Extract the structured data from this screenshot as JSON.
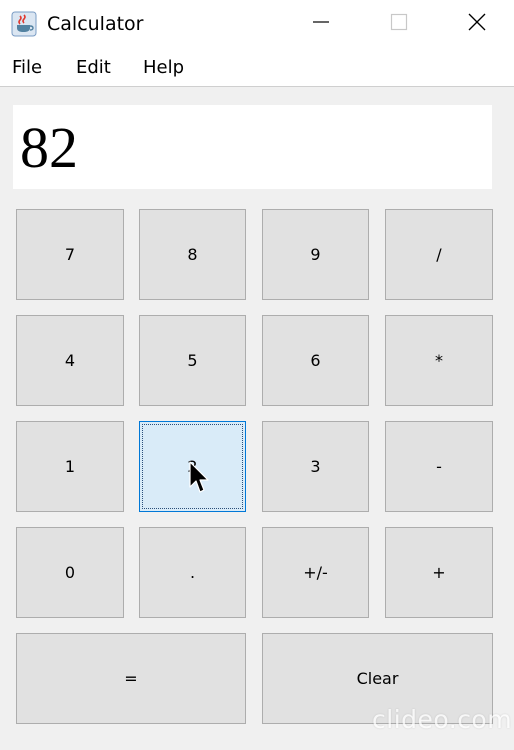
{
  "window": {
    "title": "Calculator",
    "icon": "java-cup-icon",
    "controls": [
      "minimize-icon",
      "maximize-icon",
      "close-icon"
    ]
  },
  "menubar": {
    "items": [
      {
        "label": "File"
      },
      {
        "label": "Edit"
      },
      {
        "label": "Help"
      }
    ]
  },
  "display": {
    "value": "82"
  },
  "keypad": {
    "keys": [
      {
        "label": "7"
      },
      {
        "label": "8"
      },
      {
        "label": "9"
      },
      {
        "label": "/"
      },
      {
        "label": "4"
      },
      {
        "label": "5"
      },
      {
        "label": "6"
      },
      {
        "label": "*"
      },
      {
        "label": "1"
      },
      {
        "label": "2"
      },
      {
        "label": "3"
      },
      {
        "label": "-"
      },
      {
        "label": "0"
      },
      {
        "label": "."
      },
      {
        "label": "+/-"
      },
      {
        "label": "+"
      },
      {
        "label": "="
      },
      {
        "label": "Clear"
      }
    ],
    "focused_key": "2"
  },
  "watermark": {
    "text": "clideo.com"
  },
  "colors": {
    "window_bg": "#f0f0f0",
    "button_bg": "#e1e1e1",
    "button_border": "#adadad",
    "focused_bg": "#d9ebf8",
    "focused_border": "#0078d7"
  }
}
